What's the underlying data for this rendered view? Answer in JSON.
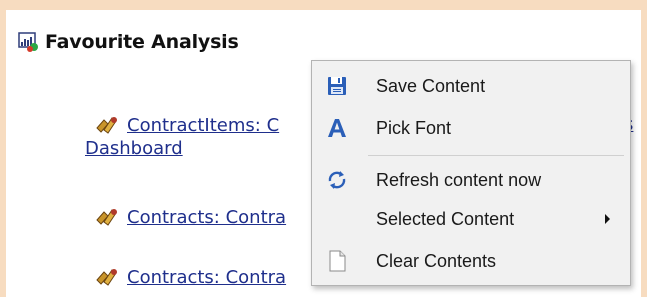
{
  "header": {
    "title": "Favourite Analysis",
    "icon": "chart-analysis-icon"
  },
  "items": [
    {
      "icon": "dashboard-tools-icon",
      "line1": "ContractItems: C",
      "line1_tail": "s",
      "line2": "Dashboard"
    },
    {
      "icon": "dashboard-tools-icon",
      "line1": "Contracts: Contra"
    },
    {
      "icon": "dashboard-tools-icon",
      "line1": "Contracts: Contra"
    }
  ],
  "context_menu": {
    "items": [
      {
        "label": "Save Content",
        "icon": "floppy-disk-icon"
      },
      {
        "label": "Pick Font",
        "icon": "font-icon"
      },
      {
        "label": "Refresh content now",
        "icon": "refresh-icon"
      },
      {
        "label": "Selected Content",
        "icon": "",
        "has_submenu": true
      },
      {
        "label": "Clear Contents",
        "icon": "blank-document-icon"
      }
    ]
  },
  "colors": {
    "background": "#f7dcc0",
    "link": "#1f2f8c",
    "menu_bg": "#f1f1f1"
  }
}
